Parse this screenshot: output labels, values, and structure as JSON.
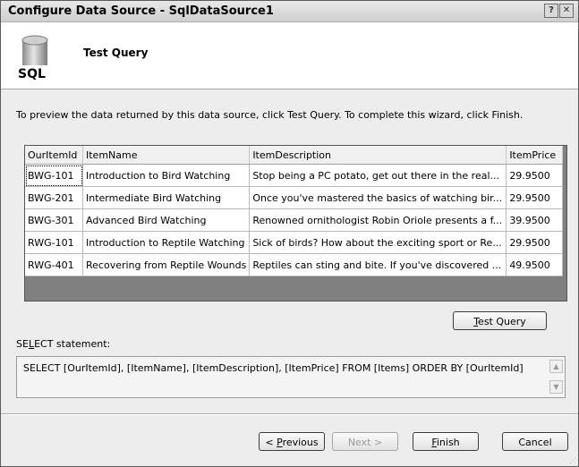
{
  "window": {
    "title": "Configure Data Source - SqlDataSource1",
    "help_label": "?",
    "close_label": "✕"
  },
  "header": {
    "icon_label": "SQL",
    "title": "Test Query"
  },
  "instruction": "To preview the data returned by this data source, click Test Query. To complete this wizard, click Finish.",
  "grid": {
    "columns": [
      "OurItemId",
      "ItemName",
      "ItemDescription",
      "ItemPrice"
    ],
    "rows": [
      [
        "BWG-101",
        "Introduction to Bird Watching",
        "Stop being a PC potato, get out there in the real...",
        "29.9500"
      ],
      [
        "BWG-201",
        "Intermediate Bird Watching",
        "Once you've mastered the basics of watching bir...",
        "29.9500"
      ],
      [
        "BWG-301",
        "Advanced Bird Watching",
        "Renowned ornithologist Robin Oriole presents a f...",
        "39.9500"
      ],
      [
        "RWG-101",
        "Introduction to Reptile Watching",
        "Sick of birds? How about the exciting sport or Re...",
        "29.9500"
      ],
      [
        "RWG-401",
        "Recovering from Reptile Wounds",
        "Reptiles can sting and bite. If you've discovered ...",
        "49.9500"
      ]
    ]
  },
  "test_query_button": {
    "mnemonic": "T",
    "rest": "est Query"
  },
  "select_label": {
    "pre": "SE",
    "mnemonic": "L",
    "post": "ECT statement:"
  },
  "sql_statement": "SELECT [OurItemId], [ItemName], [ItemDescription], [ItemPrice] FROM [Items] ORDER BY [OurItemId]",
  "footer": {
    "previous": {
      "prefix": "< ",
      "mnemonic": "P",
      "rest": "revious"
    },
    "next": "Next >",
    "finish": {
      "mnemonic": "F",
      "rest": "inish"
    },
    "cancel": "Cancel"
  }
}
